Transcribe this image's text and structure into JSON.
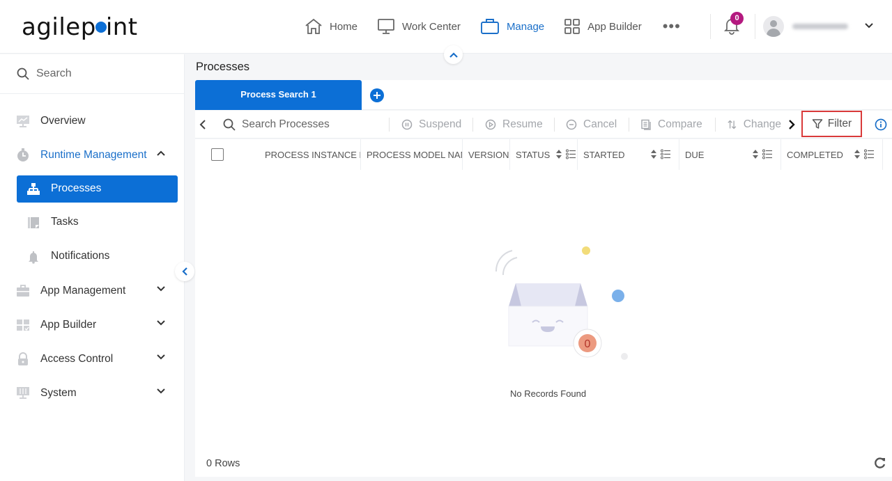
{
  "header": {
    "logo_text_a": "agilep",
    "logo_text_b": "int",
    "nav": [
      {
        "label": "Home",
        "icon": "home-icon"
      },
      {
        "label": "Work Center",
        "icon": "monitor-icon"
      },
      {
        "label": "Manage",
        "icon": "briefcase-icon",
        "active": true
      },
      {
        "label": "App Builder",
        "icon": "grid-icon"
      }
    ],
    "more_label": "•••",
    "notification_count": "0",
    "username": "(blurred)"
  },
  "sidebar": {
    "search_placeholder": "Search",
    "items": [
      {
        "label": "Overview",
        "icon": "chart-monitor-icon"
      },
      {
        "label": "Runtime Management",
        "icon": "stopwatch-icon",
        "expanded": true
      },
      {
        "label": "App Management",
        "icon": "toolbox-icon"
      },
      {
        "label": "App Builder",
        "icon": "app-grid-icon"
      },
      {
        "label": "Access Control",
        "icon": "lock-icon"
      },
      {
        "label": "System",
        "icon": "system-icon"
      }
    ],
    "subitems": [
      {
        "label": "Processes",
        "icon": "hierarchy-icon",
        "active": true
      },
      {
        "label": "Tasks",
        "icon": "tasks-icon"
      },
      {
        "label": "Notifications",
        "icon": "bell-icon"
      }
    ]
  },
  "main": {
    "title": "Processes",
    "tabs": [
      {
        "label": "Process Search 1",
        "active": true
      }
    ],
    "toolbar": {
      "search_placeholder": "Search Processes",
      "suspend": "Suspend",
      "resume": "Resume",
      "cancel": "Cancel",
      "compare": "Compare",
      "change": "Change",
      "filter": "Filter"
    },
    "columns": [
      "PROCESS INSTANCE N",
      "PROCESS MODEL NAM",
      "VERSION",
      "STATUS",
      "STARTED",
      "DUE",
      "COMPLETED"
    ],
    "empty_badge": "0",
    "empty_text": "No Records Found",
    "rows_label": "0 Rows"
  },
  "colors": {
    "accent": "#0c6fd6",
    "badge": "#b4197f",
    "filter_highlight": "#d93a3a"
  }
}
